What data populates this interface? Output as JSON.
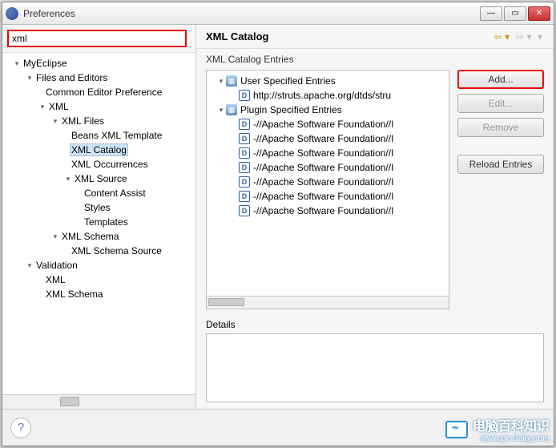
{
  "window": {
    "title": "Preferences"
  },
  "search": {
    "value": "xml"
  },
  "tree": {
    "n0": "MyEclipse",
    "n1": "Files and Editors",
    "n2": "Common Editor Preference",
    "n3": "XML",
    "n4": "XML Files",
    "n5": "Beans XML Template",
    "n6": "XML Catalog",
    "n7": "XML Occurrences",
    "n8": "XML Source",
    "n9": "Content Assist",
    "n10": "Styles",
    "n11": "Templates",
    "n12": "XML Schema",
    "n13": "XML Schema Source",
    "n14": "Validation",
    "n15": "XML",
    "n16": "XML Schema"
  },
  "right": {
    "title": "XML Catalog",
    "entries_label": "XML Catalog Entries",
    "details_label": "Details"
  },
  "entries": {
    "e0": "User Specified Entries",
    "e1": "http://struts.apache.org/dtds/stru",
    "e2": "Plugin Specified Entries",
    "e3": "-//Apache Software Foundation//I",
    "e4": "-//Apache Software Foundation//I",
    "e5": "-//Apache Software Foundation//I",
    "e6": "-//Apache Software Foundation//I",
    "e7": "-//Apache Software Foundation//I",
    "e8": "-//Apache Software Foundation//I",
    "e9": "-//Apache Software Foundation//I"
  },
  "buttons": {
    "add": "Add...",
    "edit": "Edit...",
    "remove": "Remove",
    "reload": "Reload Entries"
  },
  "watermark": {
    "text": "电脑百科知识",
    "sub": "www.pc-daily.com"
  }
}
